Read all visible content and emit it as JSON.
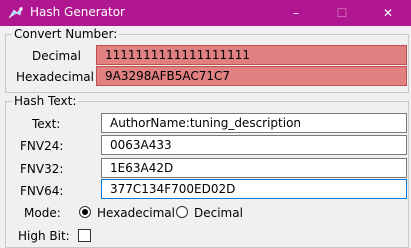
{
  "window": {
    "title": "Hash Generator",
    "controls": {
      "minimize": "–",
      "maximize": "☐",
      "close": "✕"
    }
  },
  "convert": {
    "legend": "Convert Number:",
    "decimal_label": "Decimal",
    "decimal_value": "1111111111111111111",
    "hex_label": "Hexadecimal",
    "hex_value": "9A3298AFB5AC71C7"
  },
  "hash": {
    "legend": "Hash Text:",
    "text_label": "Text:",
    "text_value": "AuthorName:tuning_description",
    "fnv24_label": "FNV24:",
    "fnv24_value": "0063A433",
    "fnv32_label": "FNV32:",
    "fnv32_value": "1E63A42D",
    "fnv64_label": "FNV64:",
    "fnv64_value": "377C134F700ED02D",
    "mode_label": "Mode:",
    "mode_options": [
      "Hexadecimal",
      "Decimal"
    ],
    "mode_selected": "Hexadecimal",
    "highbit_label": "High Bit:",
    "highbit_checked": false
  },
  "colors": {
    "titlebar": "#b0168f",
    "error_field": "#e08080",
    "focus_border": "#0078d7"
  }
}
